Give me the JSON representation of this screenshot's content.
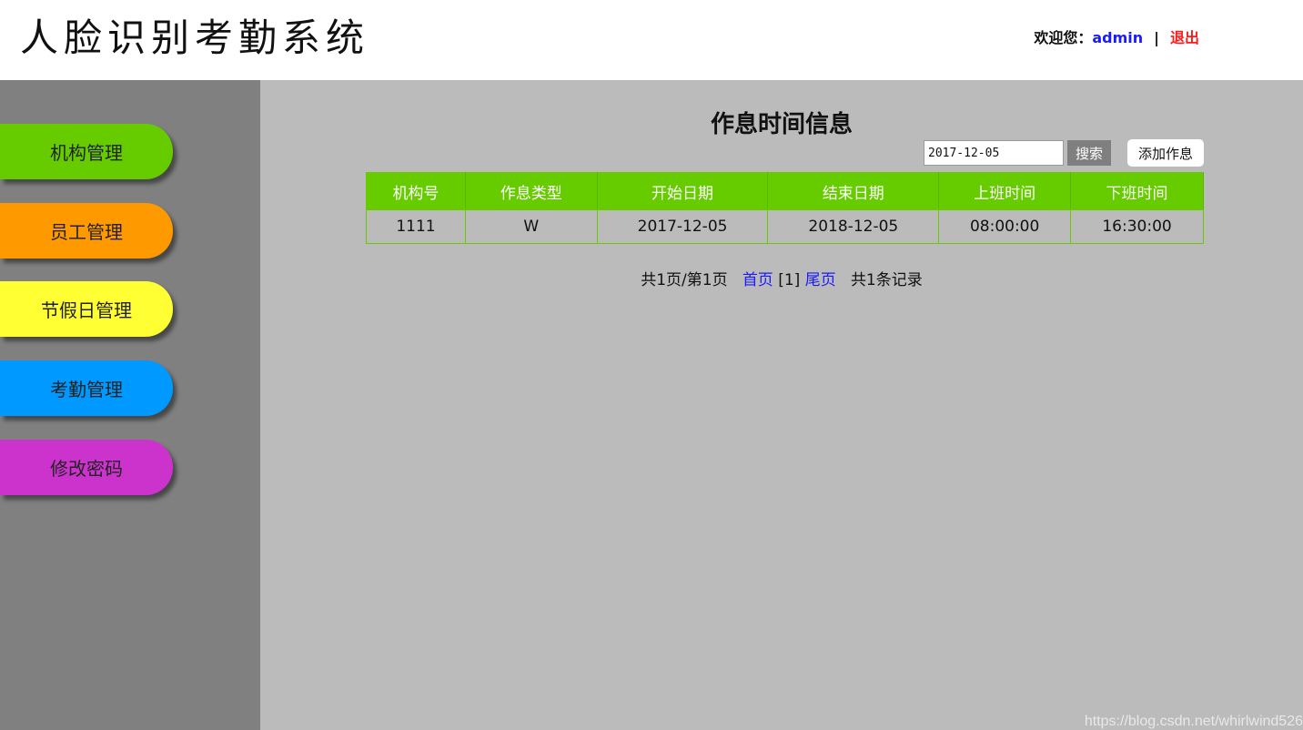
{
  "header": {
    "app_title": "人脸识别考勤系统",
    "welcome_label": "欢迎您：",
    "user_name": "admin",
    "separator": "|",
    "logout_label": "退出"
  },
  "sidebar": {
    "items": [
      {
        "label": "机构管理",
        "color": "#66cc00"
      },
      {
        "label": "员工管理",
        "color": "#ff9900"
      },
      {
        "label": "节假日管理",
        "color": "#ffff33"
      },
      {
        "label": "考勤管理",
        "color": "#0099ff"
      },
      {
        "label": "修改密码",
        "color": "#cc33cc"
      }
    ]
  },
  "main": {
    "page_title": "作息时间信息",
    "search": {
      "value": "2017-12-05",
      "button_label": "搜索"
    },
    "add_button_label": "添加作息",
    "table": {
      "columns": [
        "机构号",
        "作息类型",
        "开始日期",
        "结束日期",
        "上班时间",
        "下班时间"
      ],
      "rows": [
        [
          "1111",
          "W",
          "2017-12-05",
          "2018-12-05",
          "08:00:00",
          "16:30:00"
        ]
      ]
    },
    "pager": {
      "summary": "共1页/第1页",
      "first_label": "首页",
      "current_page": "[1]",
      "last_label": "尾页",
      "records": "共1条记录"
    }
  },
  "watermark": "https://blog.csdn.net/whirlwind526"
}
